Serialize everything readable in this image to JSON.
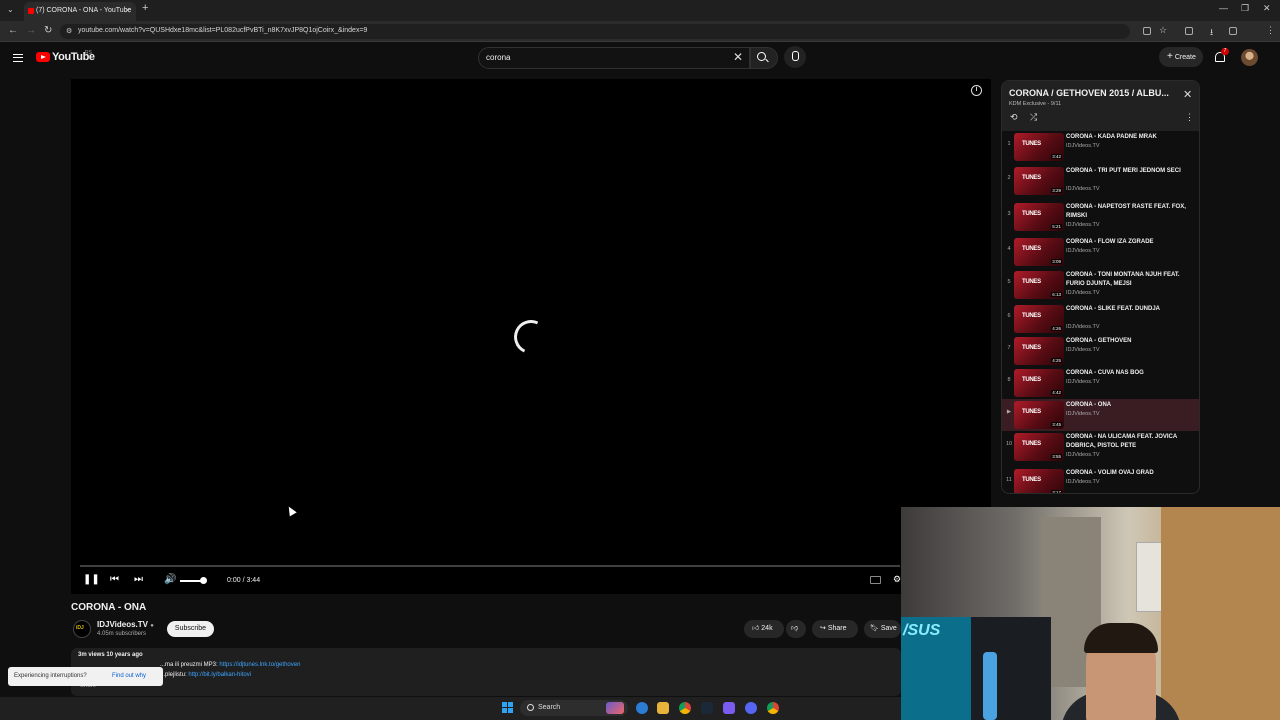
{
  "browser": {
    "tab_title": "(7) CORONA - ONA - YouTube",
    "url": "youtube.com/watch?v=QUSHdxe18mc&list=PL082ucfPvBTi_n8K7xvJP8Q1ojCoirx_&index=9"
  },
  "header": {
    "logo_text": "YouTube",
    "logo_country": "RS",
    "search_value": "corona",
    "create_label": "Create",
    "notification_count": "7"
  },
  "player": {
    "time": "0:00 / 3:44",
    "state": "loading"
  },
  "video": {
    "title": "CORONA - ONA",
    "channel": "IDJVideos.TV",
    "subscribers": "4.05m subscribers",
    "subscribe_label": "Subscribe",
    "likes": "24k",
    "share_label": "Share",
    "save_label": "Save",
    "views_meta": "3m views  10 years ago",
    "desc_line1_prefix": "...ma ili preuzmi MP3: ",
    "desc_line1_link": "https://idjtunes.lnk.to/gethoven",
    "desc_line2_prefix": "...plejlistu: ",
    "desc_line2_link": "http://bit.ly/balkan-hitovi",
    "show_more": "Share"
  },
  "toast": {
    "text": "Experiencing interruptions?",
    "link": "Find out why"
  },
  "playlist": {
    "title": "CORONA / GETHOVEN 2015 / ALBU...",
    "subtitle": "KDM Exclusive - 9/11",
    "items": [
      {
        "num": "1",
        "title": "CORONA - KADA PADNE MRAK",
        "channel": "IDJVideos.TV",
        "duration": "3:42"
      },
      {
        "num": "2",
        "title": "CORONA - TRI PUT MERI JEDNOM SECI",
        "channel": "IDJVideos.TV",
        "duration": "3:29"
      },
      {
        "num": "3",
        "title": "CORONA - NAPETOST RASTE FEAT. FOX, RIMSKI",
        "channel": "IDJVideos.TV",
        "duration": "5:21"
      },
      {
        "num": "4",
        "title": "CORONA - FLOW IZA ZGRADE",
        "channel": "IDJVideos.TV",
        "duration": "3:09"
      },
      {
        "num": "5",
        "title": "CORONA - TONI MONTANA NJUH FEAT. FURIO DJUNTA, MEJSI",
        "channel": "IDJVideos.TV",
        "duration": "6:13"
      },
      {
        "num": "6",
        "title": "CORONA - SLIKE FEAT. DUNDJA",
        "channel": "IDJVideos.TV",
        "duration": "4:26"
      },
      {
        "num": "7",
        "title": "CORONA - GETHOVEN",
        "channel": "IDJVideos.TV",
        "duration": "4:25"
      },
      {
        "num": "8",
        "title": "CORONA - CUVA NAS BOG",
        "channel": "IDJVideos.TV",
        "duration": "4:42"
      },
      {
        "num": "▶",
        "title": "CORONA - ONA",
        "channel": "IDJVideos.TV",
        "duration": "3:45"
      },
      {
        "num": "10",
        "title": "CORONA - NA ULICAMA FEAT. JOVICA DOBRICA, PISTOL PETE",
        "channel": "IDJVideos.TV",
        "duration": "3:55"
      },
      {
        "num": "11",
        "title": "CORONA - VOLIM OVAJ GRAD",
        "channel": "IDJVideos.TV",
        "duration": "3:17"
      }
    ]
  },
  "webcam": {
    "overlay_text": "/SUS"
  },
  "taskbar": {
    "search_label": "Search"
  }
}
